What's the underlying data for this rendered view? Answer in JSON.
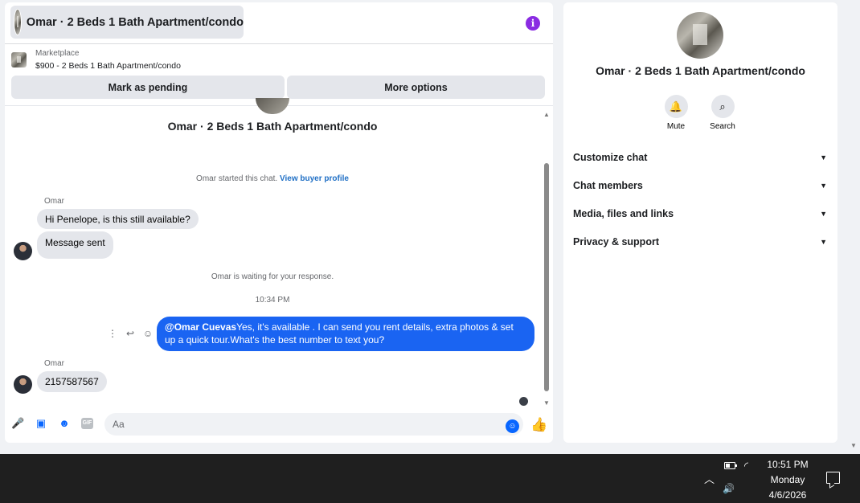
{
  "header": {
    "title": "Omar · 2 Beds 1 Bath Apartment/condo",
    "info_icon": "info-icon",
    "info_glyph": "i",
    "accent_color": "#8a2be2"
  },
  "listing": {
    "source": "Marketplace",
    "price_title": "$900 - 2 Beds 1 Bath Apartment/condo",
    "mark_pending_label": "Mark as pending",
    "more_options_label": "More options"
  },
  "conversation": {
    "title": "Omar · 2 Beds 1 Bath Apartment/condo",
    "started_text": "Omar started this chat.",
    "buyer_profile_link": "View buyer profile",
    "messages": [
      {
        "sender": "Omar",
        "text": "Hi Penelope, is this still available?"
      },
      {
        "text": "Message sent"
      }
    ],
    "waiting_text": "Omar is waiting for your response.",
    "time_separator": "10:34 PM",
    "outgoing": {
      "mention": "@Omar Cuevas",
      "text": "Yes, it's available .  I can send you rent details, extra photos & set up a quick tour.What's the best number to text you?"
    },
    "reply": {
      "sender": "Omar",
      "text": "2157587567"
    },
    "outgoing_color": "#1a64f2"
  },
  "composer": {
    "placeholder": "Aa",
    "gif_label": "GIF",
    "icons": [
      "microphone-icon",
      "photo-icon",
      "sticker-icon",
      "gif-icon",
      "emoji-icon",
      "thumbs-up-icon"
    ]
  },
  "info_panel": {
    "title": "Omar · 2 Beds 1 Bath Apartment/condo",
    "actions": [
      {
        "label": "Mute",
        "icon": "bell-icon"
      },
      {
        "label": "Search",
        "icon": "search-icon"
      }
    ],
    "sections": [
      "Customize chat",
      "Chat members",
      "Media, files and links",
      "Privacy & support"
    ]
  },
  "taskbar": {
    "time": "10:51 PM",
    "day": "Monday",
    "date": "4/6/2026"
  }
}
